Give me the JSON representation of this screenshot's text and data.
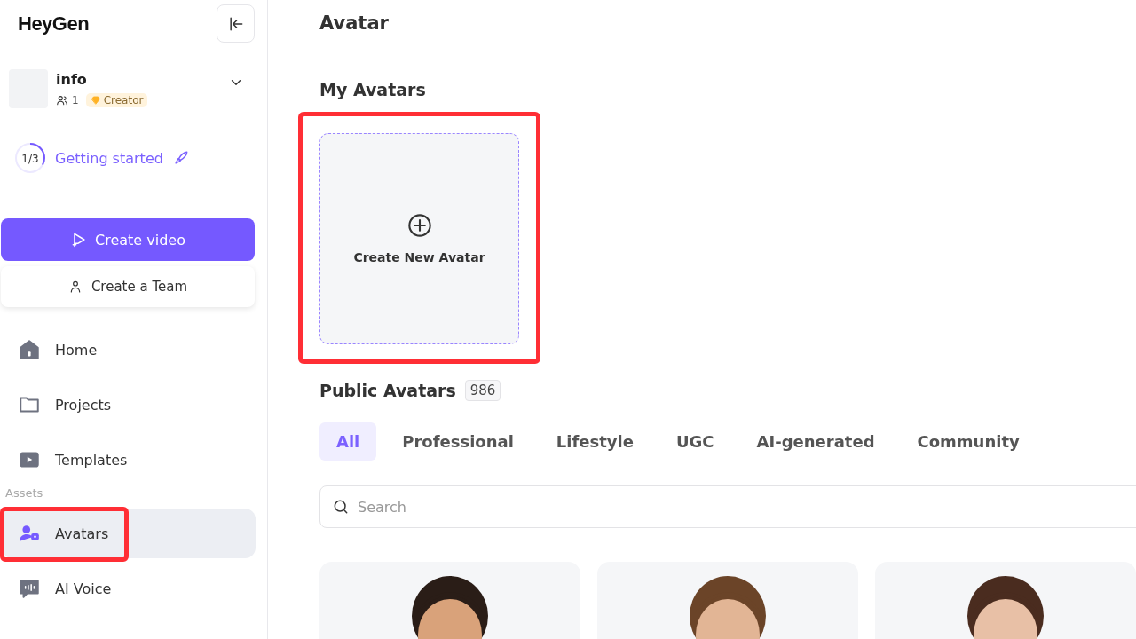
{
  "sidebar": {
    "logo": "HeyGen",
    "account": {
      "name": "info",
      "members": "1",
      "plan": "Creator"
    },
    "onboarding": {
      "progress": "1/3",
      "level": 0.33,
      "label": "Getting started"
    },
    "primary_button": "Create video",
    "secondary_button": "Create a Team",
    "nav_items": [
      {
        "label": "Home",
        "selected": false,
        "highlighted": false
      },
      {
        "label": "Projects",
        "selected": false,
        "highlighted": false
      },
      {
        "label": "Templates",
        "selected": false,
        "highlighted": false
      }
    ],
    "assets": {
      "label": "Assets",
      "items": [
        {
          "label": "Avatars",
          "selected": true,
          "highlighted": true
        },
        {
          "label": "AI Voice",
          "selected": false,
          "highlighted": false
        }
      ]
    }
  },
  "main": {
    "title": "Avatar",
    "my_avatars": {
      "heading": "My Avatars",
      "create_card": {
        "label": "Create New Avatar",
        "highlighted": true
      }
    },
    "public_avatars": {
      "heading": "Public Avatars",
      "count": "986",
      "tabs": [
        {
          "label": "All",
          "selected": true
        },
        {
          "label": "Professional",
          "selected": false
        },
        {
          "label": "Lifestyle",
          "selected": false
        },
        {
          "label": "UGC",
          "selected": false
        },
        {
          "label": "AI-generated",
          "selected": false
        },
        {
          "label": "Community",
          "selected": false
        }
      ],
      "search": {
        "placeholder": "Search"
      }
    }
  }
}
